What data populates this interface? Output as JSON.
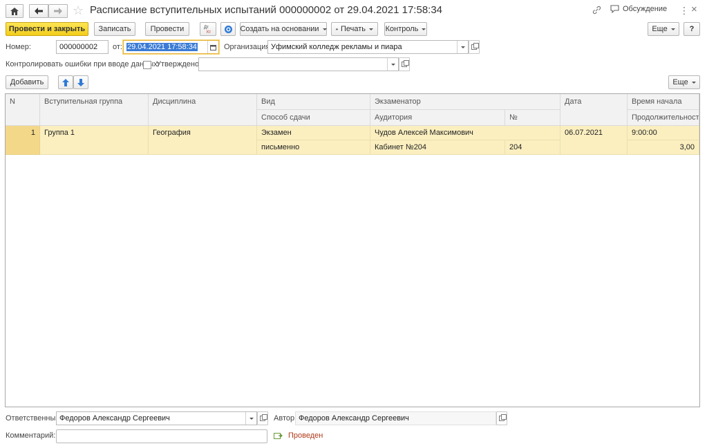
{
  "window": {
    "title": "Расписание вступительных испытаний 000000002 от 29.04.2021 17:58:34",
    "discussion_label": "Обсуждение",
    "help_label": "?"
  },
  "toolbar": {
    "post_close_label": "Провести и закрыть",
    "save_label": "Записать",
    "post_label": "Провести",
    "dt_kt_label": "Дт Кт",
    "create_based_label": "Создать на основании",
    "print_label": "Печать",
    "control_label": "Контроль",
    "more_label": "Еще"
  },
  "form": {
    "number_label": "Номер:",
    "number_value": "000000002",
    "from_label": "от:",
    "date_value": "29.04.2021 17:58:34",
    "org_label": "Организация:",
    "org_value": "Уфимский колледж рекламы и пиара",
    "control_errors_label": "Контролировать ошибки при вводе данных:",
    "approved_label": "Утверждено:",
    "approved_value": ""
  },
  "table_toolbar": {
    "add_label": "Добавить",
    "more_label": "Еще"
  },
  "table": {
    "headers": {
      "n": "N",
      "group": "Вступительная группа",
      "discipline": "Дисциплина",
      "kind": "Вид",
      "method": "Способ сдачи",
      "examiner": "Экзаменатор",
      "room": "Аудитория",
      "room_no": "№",
      "date": "Дата",
      "start_time": "Время начала",
      "duration": "Продолжительность"
    },
    "rows": [
      {
        "n": "1",
        "group": "Группа 1",
        "discipline": "География",
        "kind": "Экзамен",
        "method": "письменно",
        "examiner": "Чудов Алексей Максимович",
        "room": "Кабинет №204",
        "room_no": "204",
        "date": "06.07.2021",
        "start_time": "9:00:00",
        "duration": "3,00"
      }
    ]
  },
  "footer": {
    "responsible_label": "Ответственный:",
    "responsible_value": "Федоров Александр Сергеевич",
    "author_label": "Автор:",
    "author_value": "Федоров Александр Сергеевич",
    "comment_label": "Комментарий:",
    "comment_value": "",
    "status_label": "Проведен"
  },
  "colors": {
    "primary_button": "#f2cd1b",
    "selected_row": "#fbefc0",
    "selected_row_number": "#f4d88a",
    "status_text": "#b03a1a",
    "date_highlight": "#3a7bd5"
  }
}
